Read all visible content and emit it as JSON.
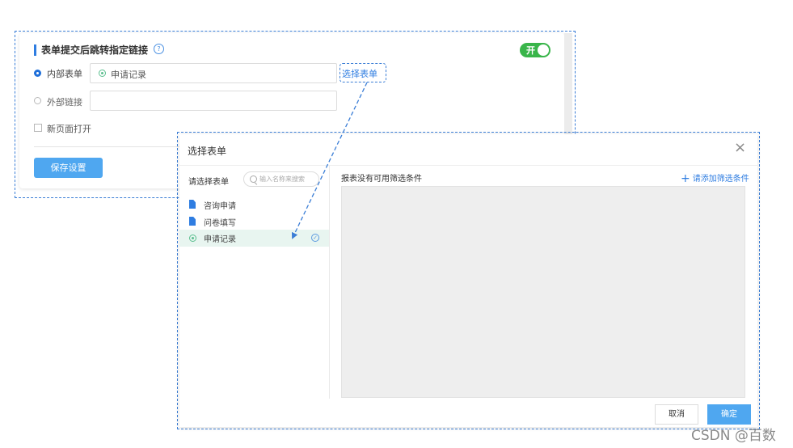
{
  "settings": {
    "section_title": "表单提交后跳转指定链接",
    "help_icon": "?",
    "toggle_label": "开",
    "toggle_on": true,
    "internal_label": "内部表单",
    "internal_value": "申请记录",
    "external_label": "外部链接",
    "external_value": "",
    "select_form_link": "选择表单",
    "new_page_label": "新页面打开",
    "save_button": "保存设置"
  },
  "dialog": {
    "title": "选择表单",
    "close_icon": "×",
    "choose_form_label": "请选择表单",
    "search_placeholder": "输入名称来搜索",
    "forms": [
      {
        "label": "咨询申请",
        "icon": "document-icon",
        "selected": false
      },
      {
        "label": "问卷填写",
        "icon": "document-icon",
        "selected": false
      },
      {
        "label": "申请记录",
        "icon": "ring-icon",
        "selected": true
      }
    ],
    "check_icon": "✓",
    "no_filter_text": "报表没有可用筛选条件",
    "add_filter_plus": "+",
    "add_filter_label": "请添加筛选条件",
    "cancel_button": "取消",
    "ok_button": "确定"
  },
  "watermark": "CSDN @百数",
  "colors": {
    "accent": "#2f7de1",
    "toggle_on": "#39b54a",
    "primary_button": "#4fa7f0",
    "selected_row": "#e8f5f0",
    "annotation_dash": "#3b7ed6"
  }
}
